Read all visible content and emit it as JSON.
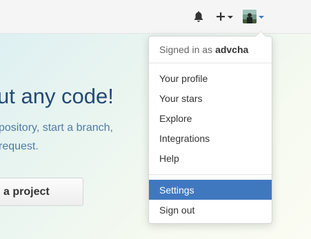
{
  "header": {
    "icons": {
      "notifications": "bell-icon",
      "create": "plus-icon",
      "avatar": "user-avatar"
    }
  },
  "hero": {
    "title": "ut any code!",
    "line1": "pository, start a branch,",
    "line2": "request.",
    "button_label": "a project"
  },
  "menu": {
    "signed_in_prefix": "Signed in as",
    "username": "advcha",
    "items": [
      {
        "label": "Your profile"
      },
      {
        "label": "Your stars"
      },
      {
        "label": "Explore"
      },
      {
        "label": "Integrations"
      },
      {
        "label": "Help"
      },
      {
        "label": "Settings",
        "active": true
      },
      {
        "label": "Sign out"
      }
    ]
  },
  "colors": {
    "accent": "#4078c0",
    "hero_title": "#234a74",
    "hero_text": "#4f7aa3"
  }
}
